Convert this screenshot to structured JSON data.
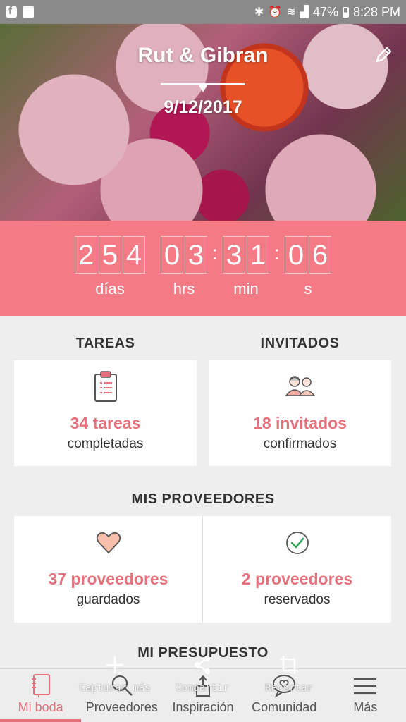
{
  "status_bar": {
    "battery": "47%",
    "time": "8:28 PM"
  },
  "hero": {
    "couple_names": "Rut & Gibran",
    "wedding_date": "9/12/2017"
  },
  "countdown": {
    "days_digits": [
      "2",
      "5",
      "4"
    ],
    "hours_digits": [
      "0",
      "3"
    ],
    "minutes_digits": [
      "3",
      "1"
    ],
    "seconds_digits": [
      "0",
      "6"
    ],
    "labels": {
      "days": "días",
      "hours": "hrs",
      "minutes": "min",
      "seconds": "s"
    }
  },
  "tasks": {
    "title": "TAREAS",
    "count_text": "34 tareas",
    "sub_text": "completadas",
    "icon": "clipboard-icon"
  },
  "guests": {
    "title": "INVITADOS",
    "count_text": "18 invitados",
    "sub_text": "confirmados",
    "icon": "guests-icon"
  },
  "providers": {
    "title": "MIS PROVEEDORES",
    "saved": {
      "count_text": "37 proveedores",
      "sub_text": "guardados",
      "icon": "heart-icon"
    },
    "booked": {
      "count_text": "2 proveedores",
      "sub_text": "reservados",
      "icon": "check-circle-icon"
    }
  },
  "budget": {
    "title": "MI PRESUPUESTO"
  },
  "overlay_actions": [
    {
      "label": "Capturar más",
      "icon": "plus-icon"
    },
    {
      "label": "Compartir",
      "icon": "share-icon"
    },
    {
      "label": "Recortar",
      "icon": "crop-icon"
    }
  ],
  "bottom_nav": [
    {
      "label": "Mi boda",
      "icon": "notebook-icon",
      "active": true
    },
    {
      "label": "Proveedores",
      "icon": "search-icon",
      "active": false
    },
    {
      "label": "Inspiración",
      "icon": "inspiration-icon",
      "active": false
    },
    {
      "label": "Comunidad",
      "icon": "chat-heart-icon",
      "active": false
    },
    {
      "label": "Más",
      "icon": "menu-icon",
      "active": false
    }
  ],
  "colors": {
    "accent": "#e6707c",
    "countdown_bg": "#f47b86",
    "status_bar": "#8a8a8a"
  }
}
